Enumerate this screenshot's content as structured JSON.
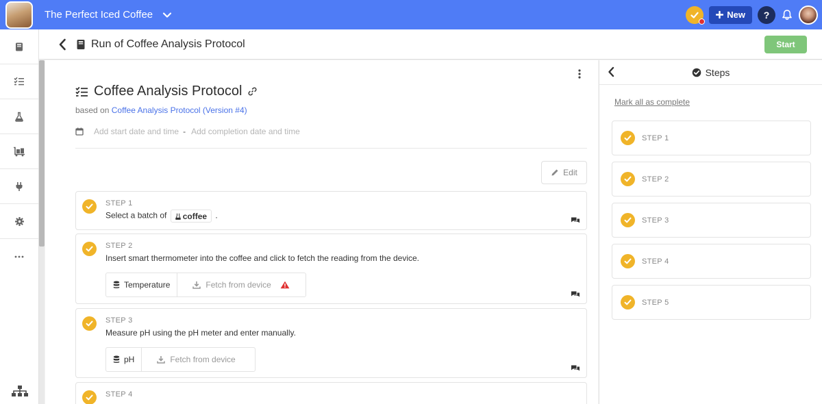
{
  "topbar": {
    "project_title": "The Perfect Iced Coffee",
    "new_label": "New",
    "help_label": "?"
  },
  "leftnav": {
    "items": [
      {
        "icon": "book-icon"
      },
      {
        "icon": "checklist-icon"
      },
      {
        "icon": "flask-icon"
      },
      {
        "icon": "inventory-icon"
      },
      {
        "icon": "plug-icon"
      },
      {
        "icon": "gear-icon"
      },
      {
        "icon": "more-icon"
      }
    ],
    "bottom_icon": "sitemap-icon"
  },
  "header": {
    "title": "Run of Coffee Analysis Protocol",
    "start_label": "Start"
  },
  "protocol": {
    "title": "Coffee Analysis Protocol",
    "based_on_prefix": "based on",
    "based_on_link": "Coffee Analysis Protocol (Version #4)",
    "start_date_placeholder": "Add start date and time",
    "date_separator": "-",
    "completion_date_placeholder": "Add completion date and time",
    "edit_label": "Edit"
  },
  "steps": [
    {
      "label": "STEP 1",
      "text_before": "Select a batch of",
      "chip": "coffee",
      "text_after": "."
    },
    {
      "label": "STEP 2",
      "text": "Insert smart thermometer into the coffee and click to fetch the reading from the device.",
      "field": "Temperature",
      "fetch": "Fetch from device",
      "warning": true
    },
    {
      "label": "STEP 3",
      "text": "Measure pH using the pH meter and enter manually.",
      "field": "pH",
      "fetch": "Fetch from device"
    },
    {
      "label": "STEP 4"
    }
  ],
  "panel": {
    "title": "Steps",
    "mark_all": "Mark all as complete",
    "items": [
      "STEP 1",
      "STEP 2",
      "STEP 3",
      "STEP 4",
      "STEP 5"
    ]
  },
  "colors": {
    "topbar": "#4f7cf6",
    "accent_link": "#4a72e8",
    "complete": "#f0b429",
    "start_button": "#7fc67a",
    "warning": "#e03131"
  }
}
